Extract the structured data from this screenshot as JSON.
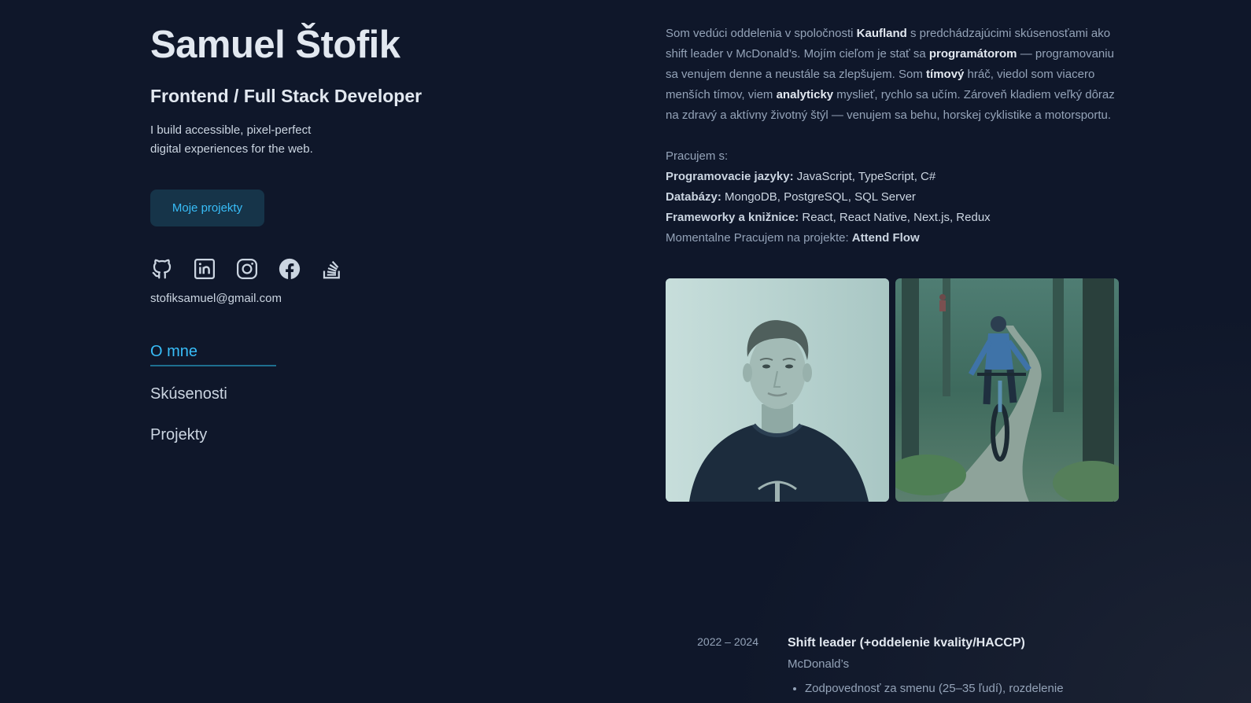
{
  "header": {
    "name": "Samuel Štofik",
    "role": "Frontend / Full Stack Developer",
    "tagline_line1": "I build accessible, pixel-perfect",
    "tagline_line2": "digital experiences for the web.",
    "cta_label": "Moje projekty"
  },
  "socials": [
    {
      "icon": "github-icon"
    },
    {
      "icon": "linkedin-icon"
    },
    {
      "icon": "instagram-icon"
    },
    {
      "icon": "facebook-icon"
    },
    {
      "icon": "stackoverflow-icon"
    }
  ],
  "email": "stofiksamuel@gmail.com",
  "nav": {
    "items": [
      {
        "label": "O mne",
        "active": true
      },
      {
        "label": "Skúsenosti",
        "active": false
      },
      {
        "label": "Projekty",
        "active": false
      }
    ]
  },
  "about": {
    "p1": "Som vedúci oddelenia v spoločnosti ",
    "kaufland": "Kaufland",
    "p2": " s predchádzajúcimi skúsenosťami ako shift leader v McDonald’s. Mojím cieľom je stať sa ",
    "programatorom": "programátorom",
    "p3": " — programovaniu sa venujem denne a neustále sa zlepšujem. Som ",
    "timovy": "tímový",
    "p4": " hráč, viedol som viacero menších tímov, viem ",
    "analyticky": "analyticky",
    "p5": " myslieť, rychlo sa učím. Zároveň kladiem veľký dôraz na zdravý a aktívny životný štýl — venujem sa behu, horskej cyklistike a motorsportu."
  },
  "skills": {
    "intro": "Pracujem s:",
    "languages_label": "Programovacie jazyky:",
    "languages_value": " JavaScript, TypeScript, C#",
    "db_label": "Databázy:",
    "db_value": " MongoDB, PostgreSQL, SQL Server",
    "frameworks_label": "Frameworky a knižnice:",
    "frameworks_value": " React, React Native, Next.js, Redux",
    "project_label": "Momentalne Pracujem na projekte: ",
    "project_value": "Attend Flow"
  },
  "experience": [
    {
      "date": "2022 – 2024",
      "title": "Shift leader (+oddelenie kvality/HACCP)",
      "company": "McDonald’s",
      "bullet": "Zodpovednosť za smenu (25–35 ľudí), rozdelenie"
    }
  ],
  "colors": {
    "background": "#0f172a",
    "accent": "#38bdf8",
    "heading": "#e2e8f0",
    "text": "#94a3b8"
  }
}
